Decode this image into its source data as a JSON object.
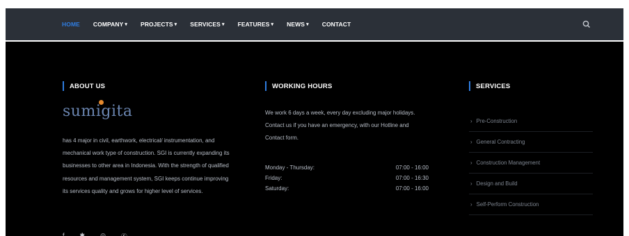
{
  "nav": {
    "items": [
      {
        "label": "HOME",
        "caret": ""
      },
      {
        "label": "COMPANY",
        "caret": "▾"
      },
      {
        "label": "PROJECTS",
        "caret": "▾"
      },
      {
        "label": "SERVICES",
        "caret": "▾"
      },
      {
        "label": "FEATURES",
        "caret": "▾"
      },
      {
        "label": "NEWS",
        "caret": "▾"
      },
      {
        "label": "CONTACT",
        "caret": ""
      }
    ],
    "search_icon": "search-icon"
  },
  "about": {
    "title": "ABOUT US",
    "logo_text": "sumigita",
    "text": "has 4 major in civil, earthwork, electrical/ instrumentation, and mechanical work type of construction. SGI is currently expanding its businesses to other area in Indonesia. With the strength of qualified resources and management system, SGI keeps continue improving its services quality and grows for higher level of services."
  },
  "hours": {
    "title": "WORKING HOURS",
    "intro": "We work 6 days a week, every day excluding major holidays. Contact us if you have an emergency, with our Hotline and Contact form.",
    "rows": [
      {
        "day": "Monday - Thursday:",
        "time": "07:00 - 16:00"
      },
      {
        "day": "Friday:",
        "time": "07:00 - 16:30"
      },
      {
        "day": "Saturday:",
        "time": "07:00 - 16:00"
      }
    ]
  },
  "services": {
    "title": "SERVICES",
    "items": [
      "Pre-Construction",
      "General Contracting",
      "Construction Management",
      "Design and Build",
      "Self-Perform Construction"
    ]
  },
  "social": {
    "icons": [
      "facebook-icon",
      "twitter-icon",
      "instagram-icon",
      "skype-icon"
    ],
    "glyphs": [
      "f",
      "✱",
      "◎",
      "Ⓢ"
    ]
  },
  "colors": {
    "accent": "#2f7de1",
    "nav_bg": "#2b3038",
    "footer_bg": "#000000"
  }
}
